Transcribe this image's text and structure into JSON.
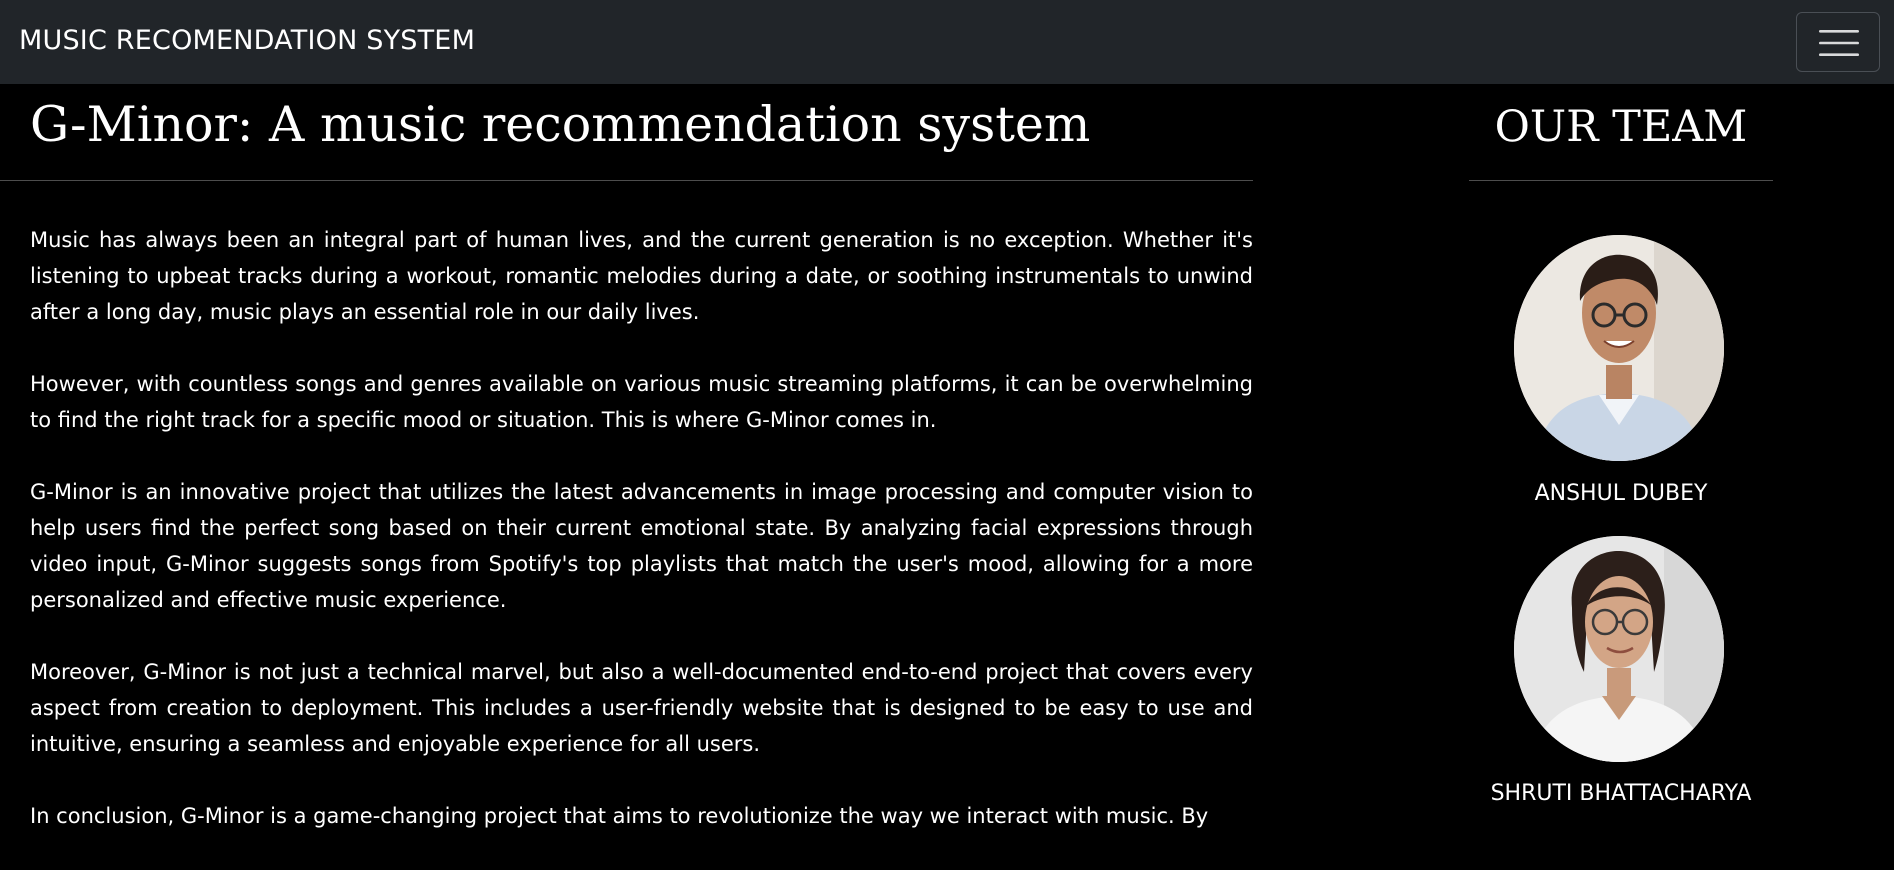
{
  "navbar": {
    "brand": "MUSIC RECOMENDATION SYSTEM",
    "toggler_icon": "hamburger-menu-icon"
  },
  "main": {
    "title": "G-Minor: A music recommendation system",
    "paragraphs": [
      "Music has always been an integral part of human lives, and the current generation is no exception. Whether it's listening to upbeat tracks during a workout, romantic melodies during a date, or soothing instrumentals to unwind after a long day, music plays an essential role in our daily lives.",
      "However, with countless songs and genres available on various music streaming platforms, it can be overwhelming to find the right track for a specific mood or situation. This is where G-Minor comes in.",
      "G-Minor is an innovative project that utilizes the latest advancements in image processing and computer vision to help users find the perfect song based on their current emotional state. By analyzing facial expressions through video input, G-Minor suggests songs from Spotify's top playlists that match the user's mood, allowing for a more personalized and effective music experience.",
      "Moreover, G-Minor is not just a technical marvel, but also a well-documented end-to-end project that covers every aspect from creation to deployment. This includes a user-friendly website that is designed to be easy to use and intuitive, ensuring a seamless and enjoyable experience for all users.",
      "In conclusion, G-Minor is a game-changing project that aims to revolutionize the way we interact with music. By"
    ]
  },
  "team": {
    "title": "OUR TEAM",
    "members": [
      {
        "name": "ANSHUL DUBEY"
      },
      {
        "name": "SHRUTI BHATTACHARYA"
      }
    ]
  },
  "colors": {
    "navbar_bg": "#212529",
    "page_bg": "#000000",
    "text": "#ffffff",
    "rule": "#4d4d4d"
  }
}
